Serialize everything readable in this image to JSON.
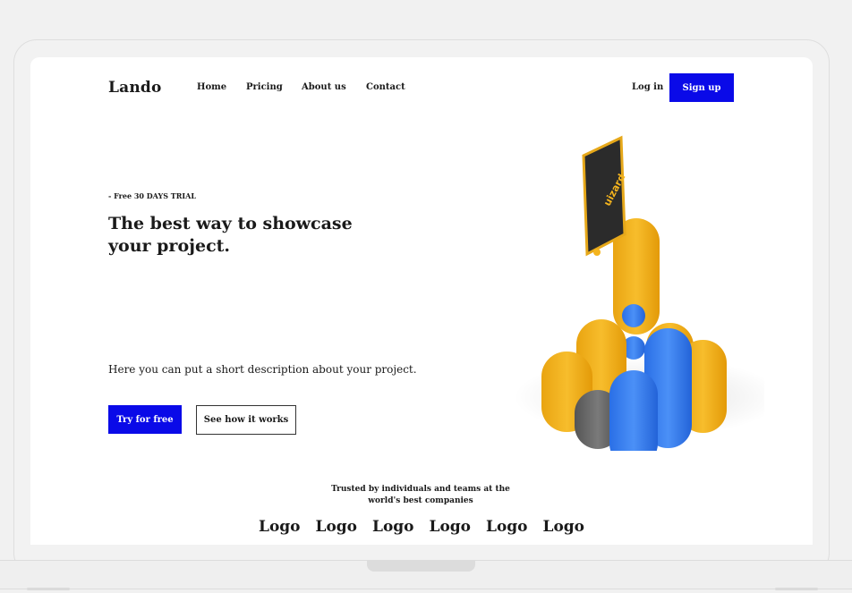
{
  "nav": {
    "brand": "Lando",
    "links": [
      "Home",
      "Pricing",
      "About us",
      "Contact"
    ],
    "login": "Log in",
    "signup": "Sign up"
  },
  "hero": {
    "badge": "- Free 30 DAYS TRIAL",
    "headline": "The best way to showcase your project.",
    "description": "Here you can put a short description about your project.",
    "primary_cta": "Try for free",
    "secondary_cta": "See how it works",
    "phone_brand": "uizard"
  },
  "trusted": {
    "text": "Trusted by individuals and teams at the world's best companies",
    "logos": [
      "Logo",
      "Logo",
      "Logo",
      "Logo",
      "Logo",
      "Logo"
    ]
  },
  "colors": {
    "accent": "#0a0ae8",
    "pill_yellow": "#f4b41e",
    "pill_blue": "#2f7af0",
    "pill_gray": "#6b6b6b"
  }
}
